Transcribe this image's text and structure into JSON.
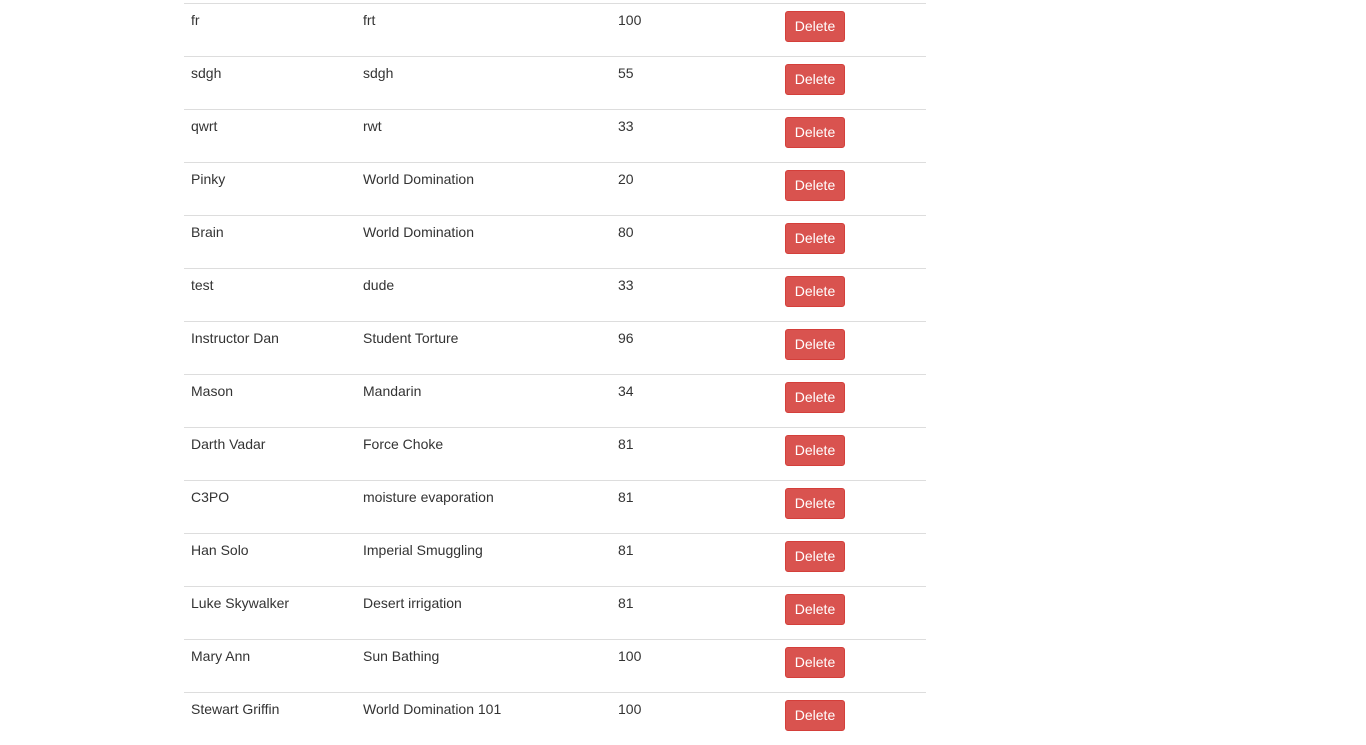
{
  "table": {
    "delete_label": "Delete",
    "rows": [
      {
        "name": "fr",
        "course": "frt",
        "grade": "100"
      },
      {
        "name": "sdgh",
        "course": "sdgh",
        "grade": "55"
      },
      {
        "name": "qwrt",
        "course": "rwt",
        "grade": "33"
      },
      {
        "name": "Pinky",
        "course": "World Domination",
        "grade": "20"
      },
      {
        "name": "Brain",
        "course": "World Domination",
        "grade": "80"
      },
      {
        "name": "test",
        "course": "dude",
        "grade": "33"
      },
      {
        "name": "Instructor Dan",
        "course": "Student Torture",
        "grade": "96"
      },
      {
        "name": "Mason",
        "course": "Mandarin",
        "grade": "34"
      },
      {
        "name": "Darth Vadar",
        "course": "Force Choke",
        "grade": "81"
      },
      {
        "name": "C3PO",
        "course": "moisture evaporation",
        "grade": "81"
      },
      {
        "name": "Han Solo",
        "course": "Imperial Smuggling",
        "grade": "81"
      },
      {
        "name": "Luke Skywalker",
        "course": "Desert irrigation",
        "grade": "81"
      },
      {
        "name": "Mary Ann",
        "course": "Sun Bathing",
        "grade": "100"
      },
      {
        "name": "Stewart Griffin",
        "course": "World Domination 101",
        "grade": "100"
      }
    ]
  },
  "colors": {
    "danger": "#d9534f",
    "danger_border": "#d43f3a",
    "row_border": "#dddddd",
    "text": "#333333"
  }
}
